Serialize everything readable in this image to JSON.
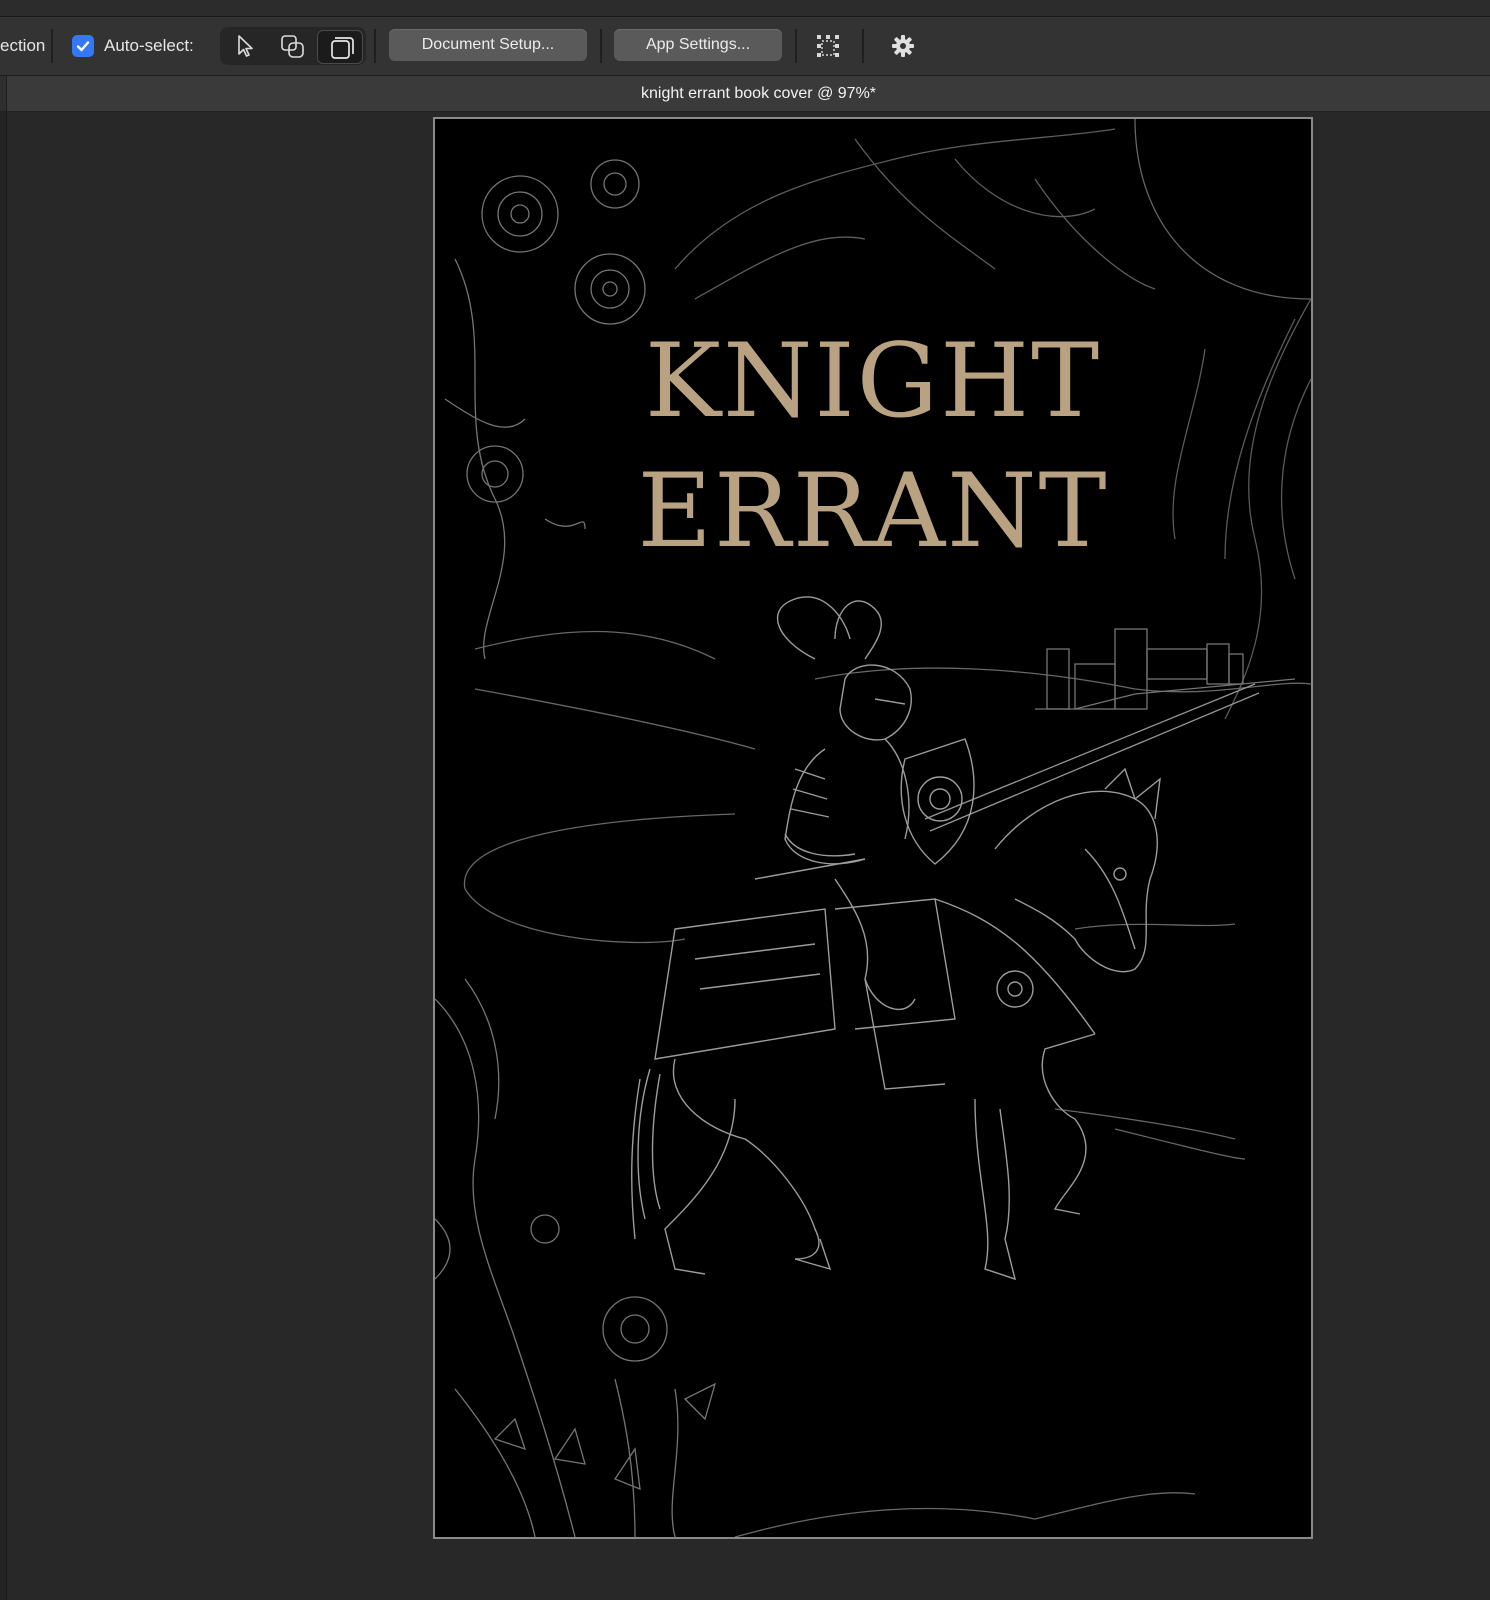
{
  "toolbar": {
    "partial_label": "ection",
    "auto_select_label": "Auto-select:",
    "auto_select_checked": true,
    "document_setup_label": "Document Setup...",
    "app_settings_label": "App Settings...",
    "icons": [
      "move-tool-icon",
      "transform-objects-icon",
      "artboard-tool-icon",
      "grid-snapping-icon",
      "gear-icon"
    ],
    "accent_color": "#3478f6"
  },
  "document": {
    "tab_title": "knight errant book cover @ 97%*"
  },
  "cover": {
    "title_line1": "KNIGHT",
    "title_line2": "ERRANT",
    "title_color": "#b8a281",
    "background_color": "#000000",
    "line_art_color": "#bdbdbd"
  }
}
